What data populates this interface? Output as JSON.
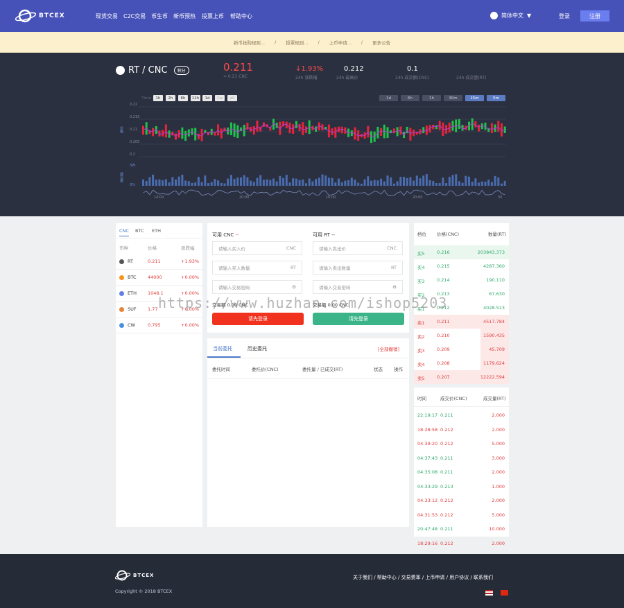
{
  "brand": "BTCEX",
  "nav": [
    "现货交易",
    "C2C交易",
    "币生币",
    "新币预热",
    "投票上币",
    "帮助中心"
  ],
  "language": "简体中文",
  "login": "登录",
  "register": "注册",
  "notices": [
    "新币抢购规则...",
    "投票规则...",
    "上币申请...",
    "更多公告"
  ],
  "pair": {
    "name": "RT / CNC",
    "badge": "积分",
    "price": "0.211",
    "price_sub": "≈ 0.21 CNC",
    "change": "↓1.93%",
    "change_label": "24h 涨跌幅",
    "high": "0.212",
    "high_label": "24h 最高价",
    "volume": "0.1",
    "volume_label": "24h 成交额(CNC)",
    "last_label": "24h 成交量(RT)"
  },
  "chart": {
    "left_tabs": [
      "Time",
      "1h",
      "2h",
      "6h",
      "12h",
      "1d",
      "1w",
      "all"
    ],
    "right_tabs": [
      "1d",
      "6h",
      "1h",
      "30m",
      "15m",
      "5m"
    ],
    "y_ticks": [
      "0.22",
      "0.215",
      "0.21",
      "0.205",
      "0.2"
    ],
    "price_label": "价格",
    "vol_label": "成交量",
    "vol_ticks": [
      "3W",
      "0%"
    ],
    "x_labels": [
      "14:00",
      "20:00",
      "16:00",
      "20:00",
      "30"
    ]
  },
  "markets": {
    "tabs": [
      "CNC",
      "BTC",
      "ETH"
    ],
    "headers": [
      "币种",
      "价格",
      "涨跌幅"
    ],
    "rows": [
      {
        "sym": "RT",
        "price": "0.211",
        "chg": "+1.93%",
        "color": "#555"
      },
      {
        "sym": "BTC",
        "price": "44000",
        "chg": "+0.00%",
        "color": "#f7931a"
      },
      {
        "sym": "ETH",
        "price": "1048.1",
        "chg": "+0.00%",
        "color": "#627eea"
      },
      {
        "sym": "SUF",
        "price": "1.77",
        "chg": "+0.00%",
        "color": "#e8833a"
      },
      {
        "sym": "CW",
        "price": "0.795",
        "chg": "+0.00%",
        "color": "#4a90e2"
      }
    ]
  },
  "trade": {
    "buy": {
      "avail": "可用 CNC",
      "dash": "--",
      "price_ph": "请输入买入价",
      "price_unit": "CNC",
      "amount_ph": "请输入买入数量",
      "amount_unit": "RT",
      "pwd_ph": "请输入交易密码",
      "total": "交易额 0.00 CNC",
      "btn": "请先登录"
    },
    "sell": {
      "avail": "可用 RT",
      "dash": "--",
      "price_ph": "请输入卖出价",
      "price_unit": "CNC",
      "amount_ph": "请输入卖出数量",
      "amount_unit": "RT",
      "pwd_ph": "请输入交易密码",
      "total": "交易额 0.00 CNC",
      "btn": "请先登录"
    }
  },
  "orders": {
    "tabs": [
      "当前委托",
      "历史委托"
    ],
    "cancel_all": "[全部撤销]",
    "headers": [
      "委托时间",
      "委托价(CNC)",
      "委托量 / 已成交(RT)",
      "状态",
      "操作"
    ]
  },
  "book": {
    "headers": [
      "档位",
      "价格(CNC)",
      "数量(RT)"
    ],
    "buys": [
      [
        "买5",
        "0.216",
        "203843.373"
      ],
      [
        "买4",
        "0.215",
        "4287.360"
      ],
      [
        "买3",
        "0.214",
        "190.110"
      ],
      [
        "买2",
        "0.213",
        "67.630"
      ],
      [
        "买1",
        "0.212",
        "4028.513"
      ]
    ],
    "sells": [
      [
        "卖1",
        "0.211",
        "4517.784"
      ],
      [
        "卖2",
        "0.210",
        "1590.435"
      ],
      [
        "卖3",
        "0.209",
        "45.709"
      ],
      [
        "卖4",
        "0.208",
        "1179.624"
      ],
      [
        "卖5",
        "0.207",
        "12222.594"
      ]
    ]
  },
  "trades": {
    "headers": [
      "时间",
      "成交价(CNC)",
      "成交量(RT)"
    ],
    "rows": [
      [
        "22:19:17",
        "0.211",
        "2.000",
        "g"
      ],
      [
        "18:28:58",
        "0.212",
        "2.000",
        "r"
      ],
      [
        "04:39:20",
        "0.212",
        "5.000",
        "r"
      ],
      [
        "04:37:43",
        "0.211",
        "3.000",
        "g"
      ],
      [
        "04:35:08",
        "0.211",
        "2.000",
        "g"
      ],
      [
        "04:33:29",
        "0.213",
        "1.000",
        "g"
      ],
      [
        "04:33:12",
        "0.212",
        "2.000",
        "r"
      ],
      [
        "04:31:53",
        "0.212",
        "5.000",
        "r"
      ],
      [
        "20:47:48",
        "0.211",
        "10.000",
        "g"
      ],
      [
        "18:29:16",
        "0.212",
        "2.000",
        "r"
      ]
    ]
  },
  "watermark": "https://www.huzhan.com/ishop5203",
  "footer": {
    "links": "关于我们 / 帮助中心 / 交易费率 / 上币申请 / 用户协议 / 联系我们",
    "copyright": "Copyright © 2018 BTCEX"
  }
}
